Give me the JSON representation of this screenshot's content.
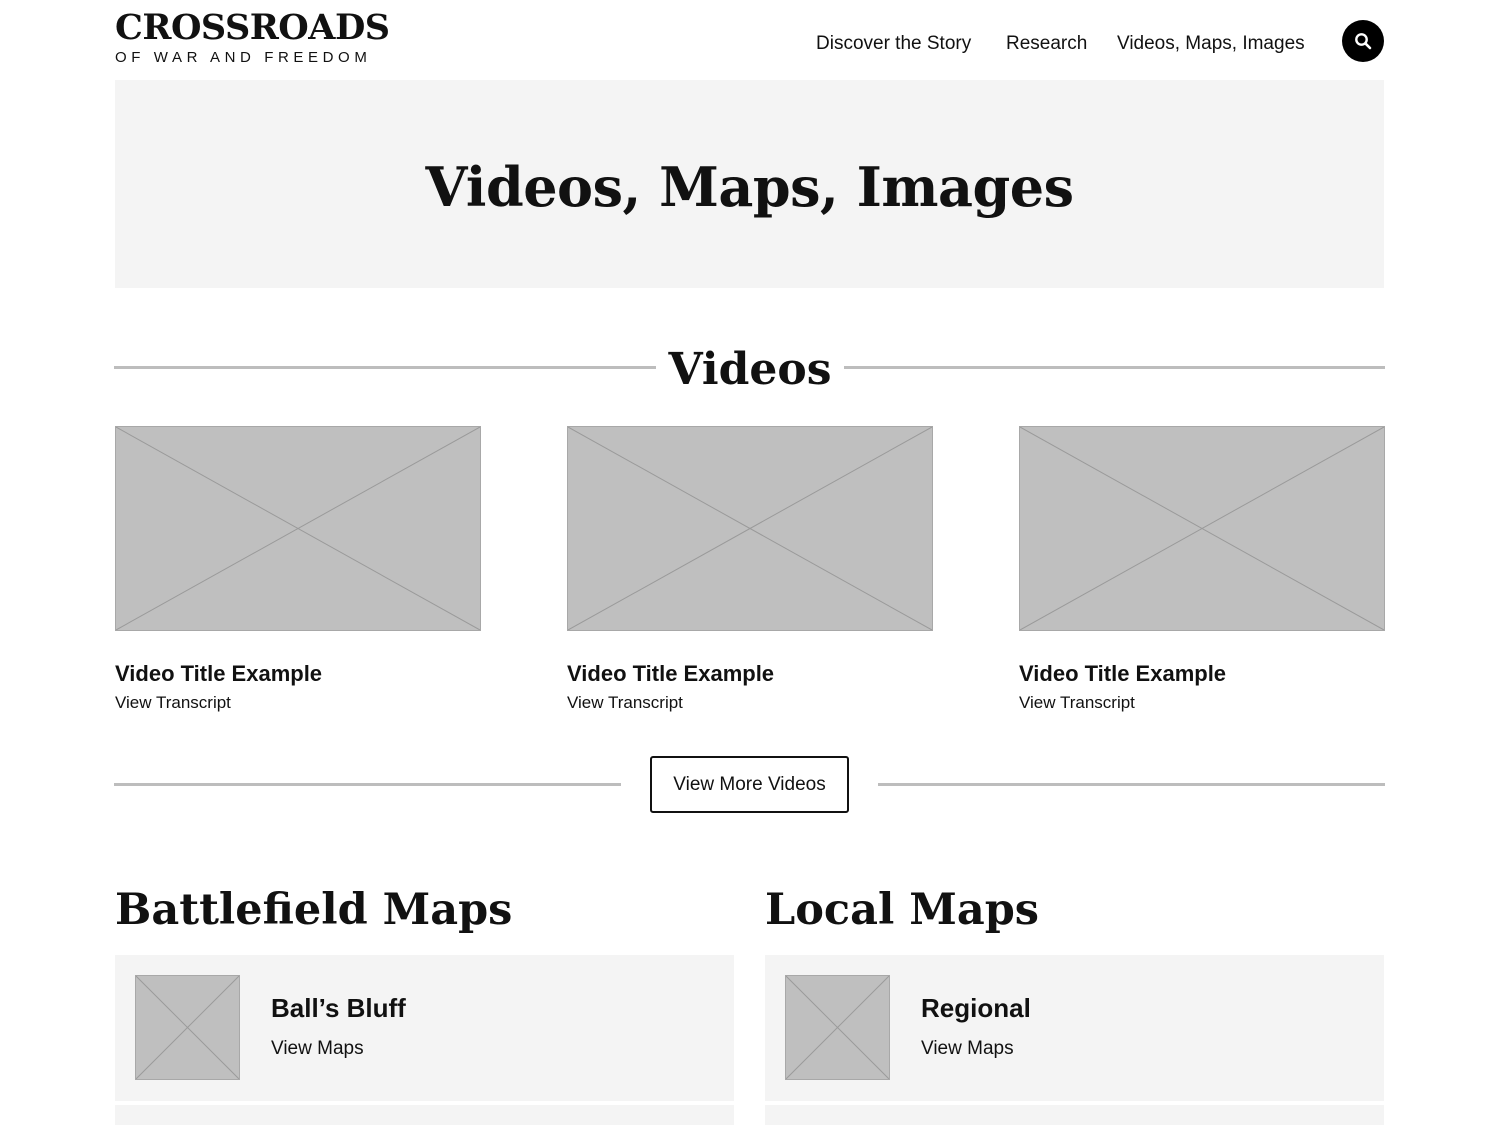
{
  "header": {
    "logo_main": "CROSSROADS",
    "logo_sub": "OF WAR AND FREEDOM",
    "nav": [
      "Discover the Story",
      "Research",
      "Videos, Maps, Images"
    ],
    "search_icon": "search-icon"
  },
  "hero": {
    "title": "Videos, Maps, Images"
  },
  "videos": {
    "title": "Videos",
    "items": [
      {
        "title": "Video Title Example",
        "link": "View Transcript"
      },
      {
        "title": "Video Title Example",
        "link": "View Transcript"
      },
      {
        "title": "Video Title Example",
        "link": "View Transcript"
      }
    ],
    "more_button": "View More Videos"
  },
  "battlefield_maps": {
    "title": "Battlefield Maps",
    "items": [
      {
        "title": "Ball’s Bluff",
        "link": "View Maps"
      }
    ]
  },
  "local_maps": {
    "title": "Local Maps",
    "items": [
      {
        "title": "Regional",
        "link": "View Maps"
      }
    ]
  },
  "colors": {
    "panel": "#f4f4f4",
    "placeholder": "#bfbfbf",
    "rule": "#bdbdbd",
    "text": "#111111"
  }
}
